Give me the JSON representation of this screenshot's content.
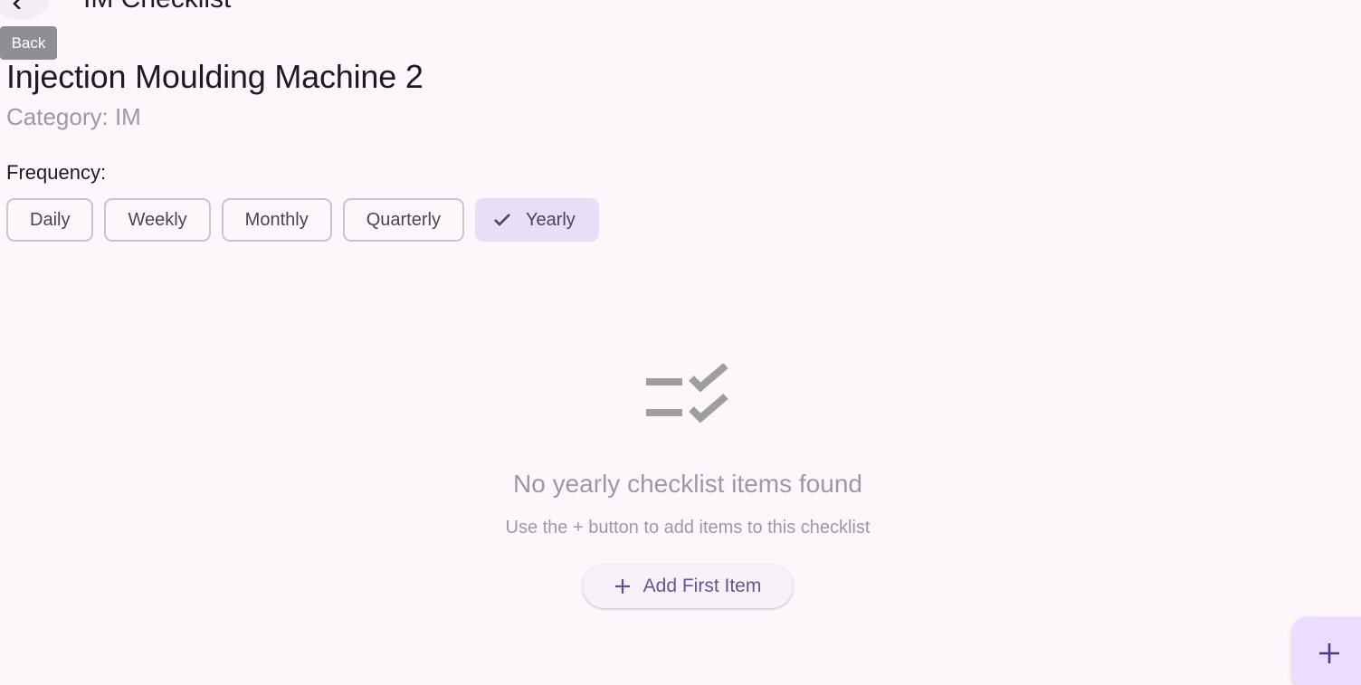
{
  "appbar": {
    "title": "IM Checklist",
    "back_tooltip": "Back"
  },
  "machine": {
    "name": "Injection Moulding Machine 2",
    "category": "Category: IM"
  },
  "frequency": {
    "label": "Frequency:",
    "options": [
      "Daily",
      "Weekly",
      "Monthly",
      "Quarterly",
      "Yearly"
    ],
    "selected": "Yearly"
  },
  "empty_state": {
    "icon": "checklist-icon",
    "title": "No yearly checklist items found",
    "subtitle": "Use the + button to add items to this checklist",
    "add_button_label": "Add First Item"
  },
  "fab": {
    "icon": "add-icon"
  },
  "colors": {
    "background": "#fdf7fc",
    "selected_chip": "#e8def8",
    "primary": "#65558f",
    "fab": "#eaddff",
    "muted_text": "#9c9aa0"
  }
}
